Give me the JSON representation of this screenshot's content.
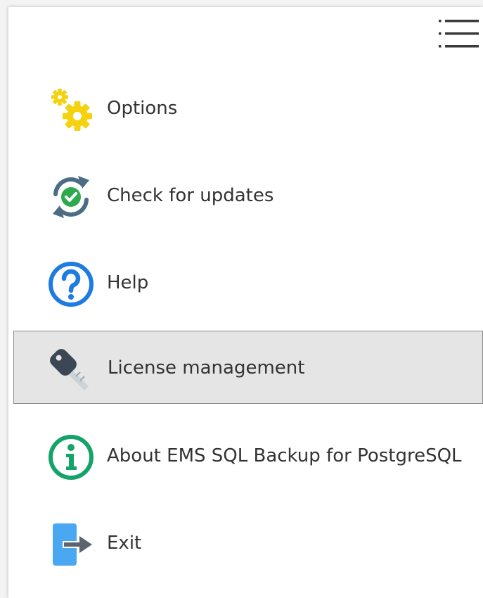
{
  "menu": {
    "toggle_icon": "hamburger-menu-icon",
    "selected_index": 3,
    "items": [
      {
        "label": "Options",
        "icon": "gears-icon"
      },
      {
        "label": "Check for updates",
        "icon": "refresh-check-icon"
      },
      {
        "label": "Help",
        "icon": "help-icon"
      },
      {
        "label": "License management",
        "icon": "key-icon"
      },
      {
        "label": "About EMS SQL Backup for PostgreSQL",
        "icon": "info-icon"
      },
      {
        "label": "Exit",
        "icon": "exit-icon"
      }
    ]
  },
  "colors": {
    "gear": "#f5d20f",
    "update_arrows": "#4a6c85",
    "update_check": "#2eaa4e",
    "help": "#1e7be0",
    "key": "#3b4754",
    "info": "#15a36c",
    "exit_door": "#4aa8f3",
    "exit_arrow": "#5a6570",
    "selected_bg": "#e5e5e5",
    "selected_border": "#8a8a8a",
    "text": "#333333"
  }
}
